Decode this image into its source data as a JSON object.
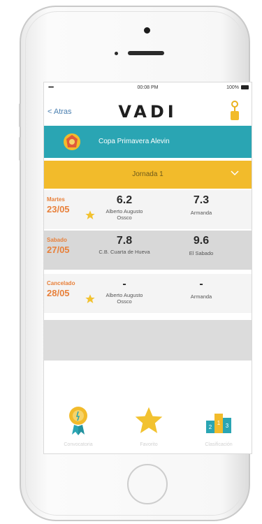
{
  "status": {
    "carrier": "•••••",
    "time": "00:08 PM",
    "battery": "100%"
  },
  "nav": {
    "back_label": "< Atras",
    "logo": "VADI"
  },
  "tournament": {
    "name": "Copa Primavera Alevin"
  },
  "jornada": {
    "label": "Jornada 1"
  },
  "matches": [
    {
      "day": "Martes",
      "date": "23/05",
      "score_1": "6.2",
      "player_1": "Alberto Augusto Ossco",
      "score_2": "7.3",
      "player_2": "Armanda"
    },
    {
      "day": "Sabado",
      "date": "27/05",
      "score_1": "7.8",
      "player_1": "C.B. Cuarta de Hueva",
      "score_2": "9.6",
      "player_2": "El Sabado"
    },
    {
      "day": "Cancelado",
      "date": "28/05",
      "score_1": "-",
      "player_1": "Alberto Augusto Ossco",
      "score_2": "-",
      "player_2": "Armanda"
    }
  ],
  "tabs": [
    {
      "label": "Convocatoria",
      "icon": "medal-icon"
    },
    {
      "label": "Favorito",
      "icon": "star-icon"
    },
    {
      "label": "Clasificación",
      "icon": "podium-icon"
    }
  ],
  "colors": {
    "teal": "#2aa5b3",
    "yellow": "#f2bb2b",
    "orange": "#e8803a"
  }
}
